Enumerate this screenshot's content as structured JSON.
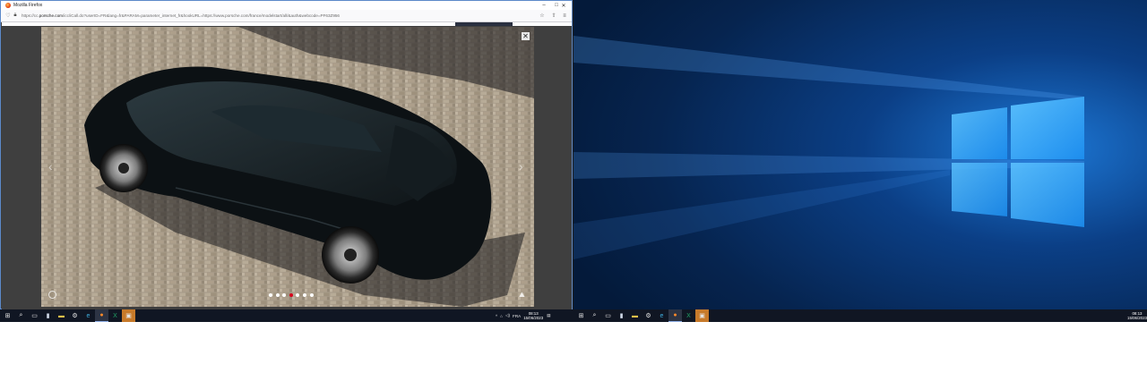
{
  "firefox": {
    "title": "Mozilla Firefox",
    "url_prefix": "https://cc.",
    "url_domain": "porsche.com",
    "url_rest": "/icc/iCall.do?userID=FR&lang=fr&PARAM=parameter_internet_fr&hookURL=https://www.porsche.com/france/modelstart/all/&auth&webcode=PF63Z956",
    "min_glyph": "–",
    "max_glyph": "□",
    "close_glyph": "✕"
  },
  "gallery": {
    "close_glyph": "✕",
    "prev_glyph": "‹",
    "next_glyph": "›",
    "dot_count": 7,
    "active_dot": 4
  },
  "taskbar_left": {
    "language": "FRA",
    "time": "08:13",
    "date": "15/06/2023"
  },
  "taskbar_right": {
    "time": "08:13",
    "date": "15/06/2023"
  },
  "colors": {
    "taskbar": "#101623",
    "accent_red": "#d5001c",
    "firefox_border": "#5c89c9",
    "desktop_blue": "#0b3a75"
  },
  "icons": [
    "windows-start-icon",
    "search-icon",
    "task-view-icon",
    "file-explorer-icon",
    "folder-icon",
    "settings-icon",
    "edge-icon",
    "firefox-icon",
    "excel-icon",
    "remote-desktop-icon"
  ]
}
